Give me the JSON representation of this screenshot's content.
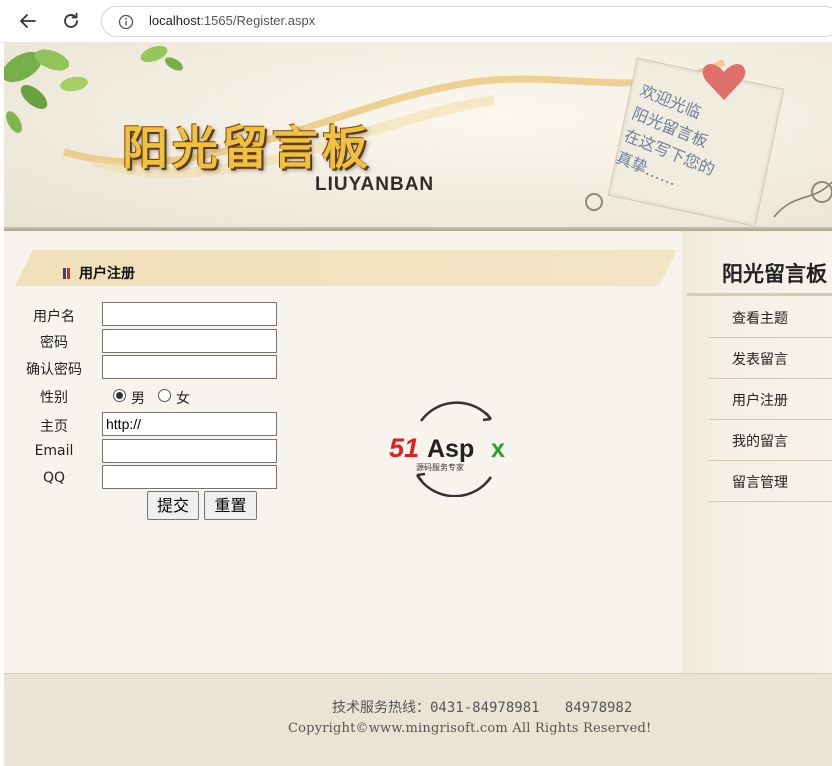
{
  "browser": {
    "url_host": "localhost",
    "url_path": ":1565/Register.aspx"
  },
  "banner": {
    "title": "阳光留言板",
    "subtitle": "LIUYANBAN",
    "note_lines": [
      "欢迎光临",
      "阳光留言板",
      "在这写下您的",
      "真挚……"
    ]
  },
  "section": {
    "title": "用户注册"
  },
  "form": {
    "username_label": "用户名",
    "password_label": "密码",
    "confirm_label": "确认密码",
    "gender_label": "性别",
    "gender_male": "男",
    "gender_female": "女",
    "gender_selected": "男",
    "homepage_label": "主页",
    "homepage_value": "http://",
    "email_label": "Email",
    "qq_label": "QQ",
    "submit_label": "提交",
    "reset_label": "重置"
  },
  "logo": {
    "brand": "51Aspx",
    "tagline": "源码服务专家"
  },
  "sidebar": {
    "title": "阳光留言板",
    "items": [
      {
        "label": "查看主题"
      },
      {
        "label": "发表留言"
      },
      {
        "label": "用户注册"
      },
      {
        "label": "我的留言"
      },
      {
        "label": "留言管理"
      }
    ]
  },
  "footer": {
    "hotline": "技术服务热线：0431-84978981   84978982",
    "copyright": "Copyright©www.mingrisoft.com All Rights Reserved!"
  },
  "colors": {
    "page_bg": "#f6f4ec",
    "section_band": "#f0dfb8",
    "title_gold": "#f0c040",
    "footer_bg": "#ebe4d6",
    "logo_red": "#e02020",
    "logo_green": "#2aa02a"
  }
}
